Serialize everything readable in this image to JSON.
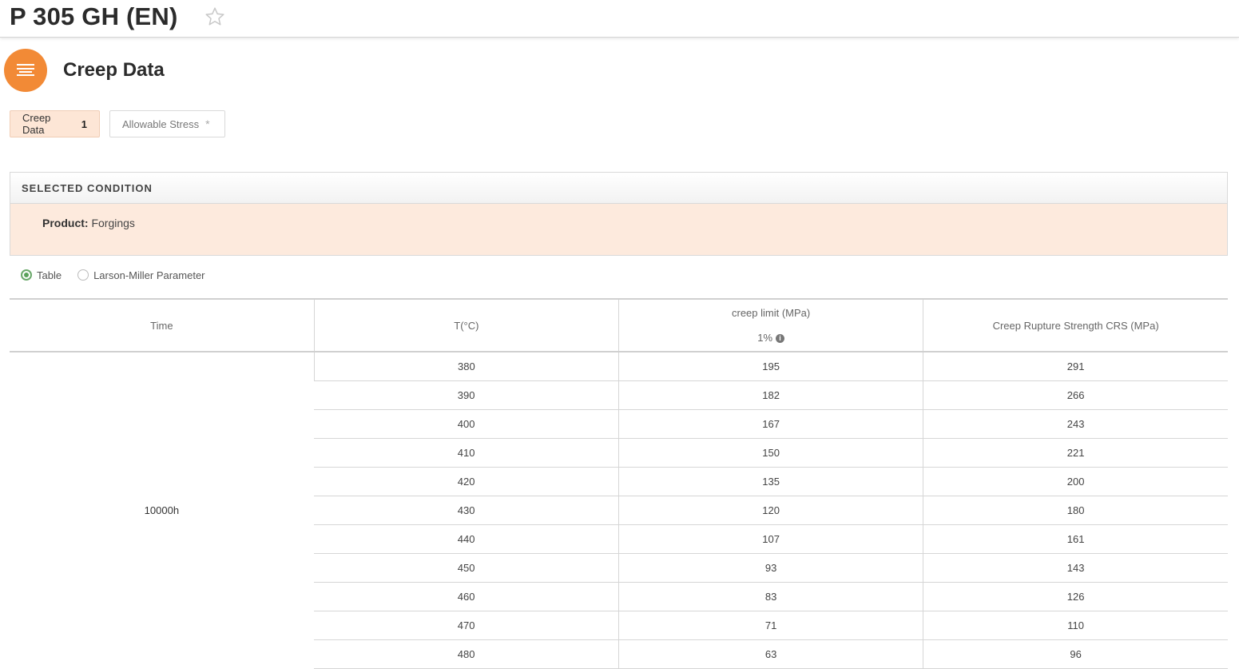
{
  "header": {
    "material_title": "P 305 GH (EN)",
    "favorite_icon": "star-outline-icon"
  },
  "section": {
    "icon": "list-lines-icon",
    "icon_color": "#f28a36",
    "title": "Creep Data"
  },
  "tabs": [
    {
      "label": "Creep Data",
      "count": "1",
      "active": true
    },
    {
      "label": "Allowable Stress",
      "count": "*",
      "active": false
    }
  ],
  "condition": {
    "header": "SELECTED CONDITION",
    "product_label": "Product:",
    "product_value": "Forgings"
  },
  "view_options": {
    "table_label": "Table",
    "lmp_label": "Larson-Miller Parameter",
    "selected": "Table"
  },
  "table": {
    "columns": {
      "time": "Time",
      "temp": "T(°C)",
      "creep_limit": "creep limit (MPa)",
      "creep_limit_sub": "1%",
      "crs": "Creep Rupture Strength CRS (MPa)"
    },
    "time_value": "10000h",
    "rows": [
      {
        "temp": "380",
        "creep": "195",
        "crs": "291"
      },
      {
        "temp": "390",
        "creep": "182",
        "crs": "266"
      },
      {
        "temp": "400",
        "creep": "167",
        "crs": "243"
      },
      {
        "temp": "410",
        "creep": "150",
        "crs": "221"
      },
      {
        "temp": "420",
        "creep": "135",
        "crs": "200"
      },
      {
        "temp": "430",
        "creep": "120",
        "crs": "180"
      },
      {
        "temp": "440",
        "creep": "107",
        "crs": "161"
      },
      {
        "temp": "450",
        "creep": "93",
        "crs": "143"
      },
      {
        "temp": "460",
        "creep": "83",
        "crs": "126"
      },
      {
        "temp": "470",
        "creep": "71",
        "crs": "110"
      },
      {
        "temp": "480",
        "creep": "63",
        "crs": "96"
      }
    ]
  }
}
